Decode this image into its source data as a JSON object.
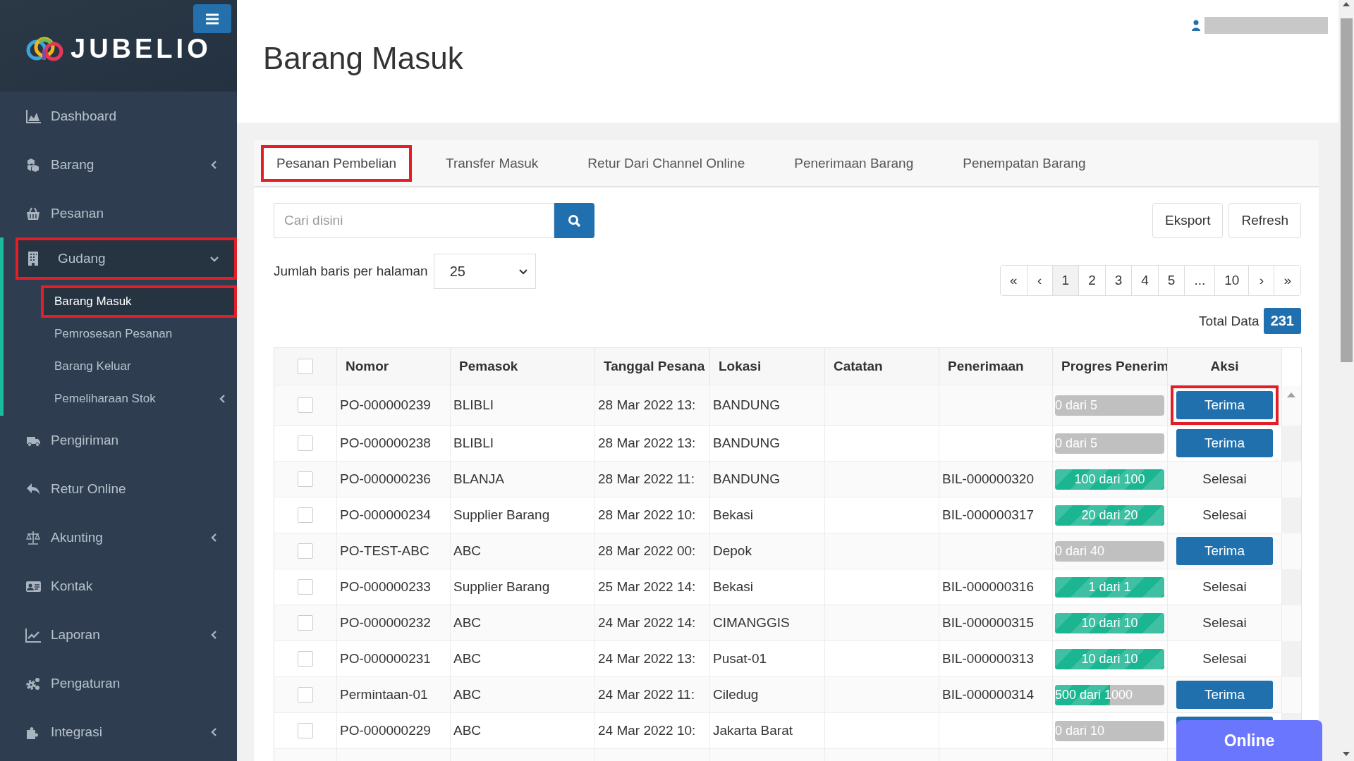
{
  "sidebar": {
    "logo_text": "JUBELIO",
    "items": [
      {
        "label": "Dashboard",
        "kind": "link",
        "selected": false,
        "highlighted": false
      },
      {
        "label": "Barang",
        "kind": "group",
        "expanded": false,
        "selected": false,
        "highlighted": false
      },
      {
        "label": "Pesanan",
        "kind": "link",
        "selected": false,
        "highlighted": false
      },
      {
        "label": "Gudang",
        "kind": "group",
        "expanded": true,
        "selected": true,
        "highlighted": true,
        "children": [
          {
            "label": "Barang Masuk",
            "kind": "link",
            "selected": true,
            "highlighted": true
          },
          {
            "label": "Pemrosesan Pesanan",
            "kind": "link",
            "selected": false,
            "highlighted": false
          },
          {
            "label": "Barang Keluar",
            "kind": "link",
            "selected": false,
            "highlighted": false
          },
          {
            "label": "Pemeliharaan Stok",
            "kind": "group",
            "expanded": false,
            "selected": false,
            "highlighted": false
          }
        ]
      },
      {
        "label": "Pengiriman",
        "kind": "link",
        "selected": false,
        "highlighted": false
      },
      {
        "label": "Retur Online",
        "kind": "link",
        "selected": false,
        "highlighted": false
      },
      {
        "label": "Akunting",
        "kind": "group",
        "expanded": false,
        "selected": false,
        "highlighted": false
      },
      {
        "label": "Kontak",
        "kind": "link",
        "selected": false,
        "highlighted": false
      },
      {
        "label": "Laporan",
        "kind": "group",
        "expanded": false,
        "selected": false,
        "highlighted": false
      },
      {
        "label": "Pengaturan",
        "kind": "link",
        "selected": false,
        "highlighted": false
      },
      {
        "label": "Integrasi",
        "kind": "group",
        "expanded": false,
        "selected": false,
        "highlighted": false
      }
    ]
  },
  "page_title": "Barang Masuk",
  "tabs": [
    {
      "label": "Pesanan Pembelian",
      "selected": true,
      "highlighted": true
    },
    {
      "label": "Transfer Masuk",
      "selected": false,
      "highlighted": false
    },
    {
      "label": "Retur Dari Channel Online",
      "selected": false,
      "highlighted": false
    },
    {
      "label": "Penerimaan Barang",
      "selected": false,
      "highlighted": false
    },
    {
      "label": "Penempatan Barang",
      "selected": false,
      "highlighted": false
    }
  ],
  "search": {
    "placeholder": "Cari disini"
  },
  "buttons": [
    "Eksport",
    "Refresh"
  ],
  "page_size": {
    "label": "Jumlah baris per halaman",
    "value": "25"
  },
  "pagination": [
    {
      "label": "«",
      "selected": false
    },
    {
      "label": "‹",
      "selected": false
    },
    {
      "label": "1",
      "selected": true
    },
    {
      "label": "2",
      "selected": false
    },
    {
      "label": "3",
      "selected": false
    },
    {
      "label": "4",
      "selected": false
    },
    {
      "label": "5",
      "selected": false
    },
    {
      "label": "...",
      "selected": false
    },
    {
      "label": "10",
      "selected": false
    },
    {
      "label": "›",
      "selected": false
    },
    {
      "label": "»",
      "selected": false
    }
  ],
  "total": {
    "label": "Total Data",
    "value": "231"
  },
  "table": {
    "select_all_checked": false,
    "columns": [
      "Nomor",
      "Pemasok",
      "Tanggal Pesana",
      "Lokasi",
      "Catatan",
      "Penerimaan",
      "Progres Penerim",
      "Aksi"
    ],
    "rows": [
      {
        "checked": false,
        "nomor": "PO-000000239",
        "pemasok": "BLIBLI",
        "tanggal": "28 Mar 2022 13:",
        "lokasi": "BANDUNG",
        "progress": {
          "label": "0 dari 5",
          "level": 0
        },
        "action": {
          "kind": "button",
          "label": "Terima",
          "highlighted": true
        }
      },
      {
        "checked": false,
        "nomor": "PO-000000238",
        "pemasok": "BLIBLI",
        "tanggal": "28 Mar 2022 13:",
        "lokasi": "BANDUNG",
        "progress": {
          "label": "0 dari 5",
          "level": 0
        },
        "action": {
          "kind": "button",
          "label": "Terima",
          "highlighted": false
        }
      },
      {
        "checked": false,
        "nomor": "PO-000000236",
        "pemasok": "BLANJA",
        "tanggal": "28 Mar 2022 11:",
        "lokasi": "BANDUNG",
        "penerimaan": "BIL-000000320",
        "progress": {
          "label": "100 dari 100",
          "level": 1
        },
        "action": {
          "kind": "text",
          "label": "Selesai",
          "highlighted": false
        }
      },
      {
        "checked": false,
        "nomor": "PO-000000234",
        "pemasok": "Supplier Barang",
        "tanggal": "28 Mar 2022 10:",
        "lokasi": "Bekasi",
        "penerimaan": "BIL-000000317",
        "progress": {
          "label": "20 dari 20",
          "level": 1
        },
        "action": {
          "kind": "text",
          "label": "Selesai",
          "highlighted": false
        }
      },
      {
        "checked": false,
        "nomor": "PO-TEST-ABC",
        "pemasok": "ABC",
        "tanggal": "28 Mar 2022 00:",
        "lokasi": "Depok",
        "progress": {
          "label": "0 dari 40",
          "level": 0
        },
        "action": {
          "kind": "button",
          "label": "Terima",
          "highlighted": false
        }
      },
      {
        "checked": false,
        "nomor": "PO-000000233",
        "pemasok": "Supplier Barang",
        "tanggal": "25 Mar 2022 14:",
        "lokasi": "Bekasi",
        "penerimaan": "BIL-000000316",
        "progress": {
          "label": "1 dari 1",
          "level": 1
        },
        "action": {
          "kind": "text",
          "label": "Selesai",
          "highlighted": false
        }
      },
      {
        "checked": false,
        "nomor": "PO-000000232",
        "pemasok": "ABC",
        "tanggal": "24 Mar 2022 14:",
        "lokasi": "CIMANGGIS",
        "penerimaan": "BIL-000000315",
        "progress": {
          "label": "10 dari 10",
          "level": 1
        },
        "action": {
          "kind": "text",
          "label": "Selesai",
          "highlighted": false
        }
      },
      {
        "checked": false,
        "nomor": "PO-000000231",
        "pemasok": "ABC",
        "tanggal": "24 Mar 2022 13:",
        "lokasi": "Pusat-01",
        "penerimaan": "BIL-000000313",
        "progress": {
          "label": "10 dari 10",
          "level": 1
        },
        "action": {
          "kind": "text",
          "label": "Selesai",
          "highlighted": false
        }
      },
      {
        "checked": false,
        "nomor": "Permintaan-01",
        "pemasok": "ABC",
        "tanggal": "24 Mar 2022 11:",
        "lokasi": "Ciledug",
        "penerimaan": "BIL-000000314",
        "progress": {
          "label": "500 dari 1000",
          "level": 0.5
        },
        "action": {
          "kind": "button",
          "label": "Terima",
          "highlighted": false
        }
      },
      {
        "checked": false,
        "nomor": "PO-000000229",
        "pemasok": "ABC",
        "tanggal": "24 Mar 2022 10:",
        "lokasi": "Jakarta Barat",
        "progress": {
          "label": "0 dari 10",
          "level": 0
        },
        "action": {
          "kind": "button",
          "highlighted": false
        }
      }
    ]
  },
  "chat": {
    "label": "Online"
  }
}
